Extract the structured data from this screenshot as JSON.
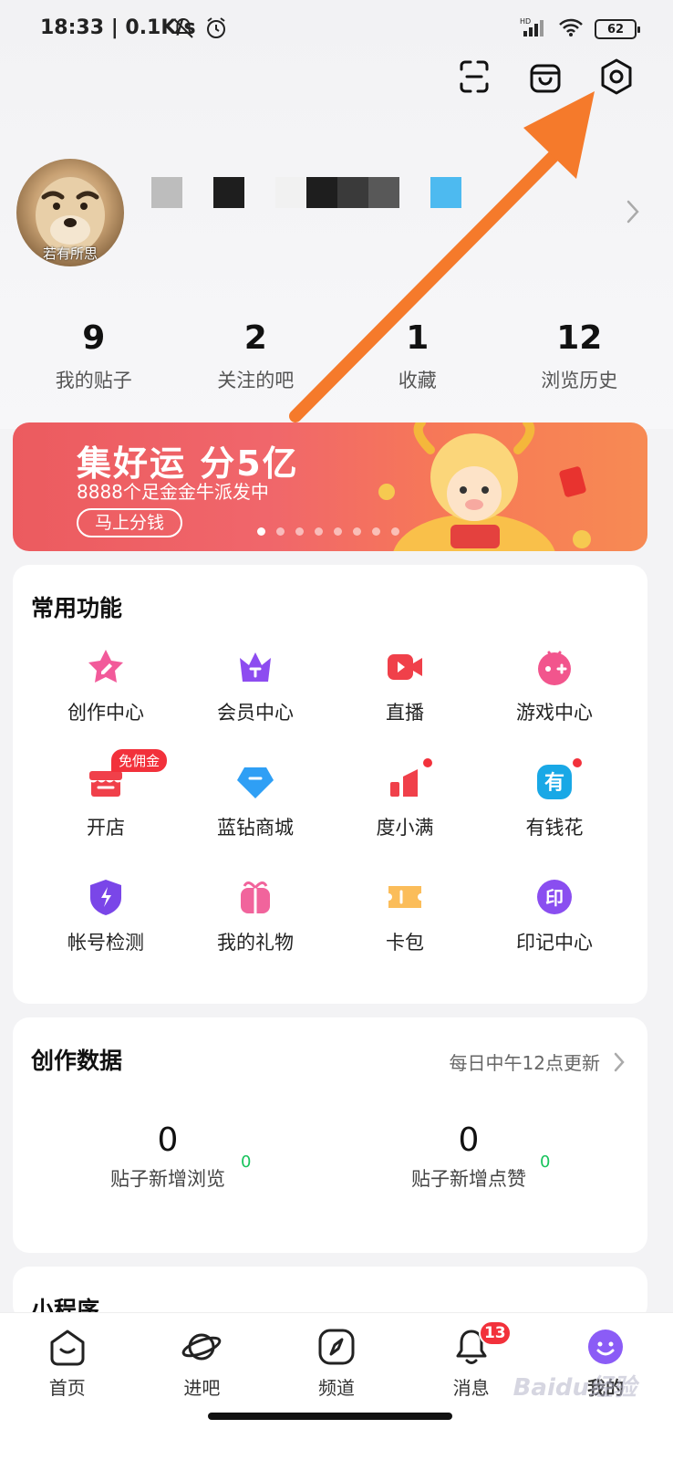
{
  "status_bar": {
    "time": "18:33 | 0.1K/s",
    "battery": "62",
    "network_label": "HD"
  },
  "profile": {
    "avatar_caption": "若有所思"
  },
  "stats": [
    {
      "num": "9",
      "label": "我的贴子"
    },
    {
      "num": "2",
      "label": "关注的吧"
    },
    {
      "num": "1",
      "label": "收藏"
    },
    {
      "num": "12",
      "label": "浏览历史"
    }
  ],
  "banner": {
    "title": "集好运 分5亿",
    "subtitle": "8888个足金金牛派发中",
    "button": "马上分钱",
    "dot_count": 8,
    "active_dot": 0
  },
  "common_functions": {
    "title": "常用功能",
    "items": [
      {
        "label": "创作中心",
        "icon": "star-pen-icon"
      },
      {
        "label": "会员中心",
        "icon": "crown-icon"
      },
      {
        "label": "直播",
        "icon": "video-camera-icon"
      },
      {
        "label": "游戏中心",
        "icon": "gamepad-icon"
      },
      {
        "label": "开店",
        "icon": "shop-icon",
        "badge": "免佣金"
      },
      {
        "label": "蓝钻商城",
        "icon": "diamond-icon"
      },
      {
        "label": "度小满",
        "icon": "bar-chart-icon"
      },
      {
        "label": "有钱花",
        "icon": "you-icon",
        "icon_text": "有"
      },
      {
        "label": "帐号检测",
        "icon": "shield-bolt-icon"
      },
      {
        "label": "我的礼物",
        "icon": "gift-icon"
      },
      {
        "label": "卡包",
        "icon": "ticket-icon"
      },
      {
        "label": "印记中心",
        "icon": "seal-icon",
        "icon_text": "印"
      }
    ]
  },
  "creation_data": {
    "title": "创作数据",
    "update_note": "每日中午12点更新",
    "items": [
      {
        "num": "0",
        "label": "贴子新增浏览",
        "delta": "0"
      },
      {
        "num": "0",
        "label": "贴子新增点赞",
        "delta": "0"
      }
    ]
  },
  "mini_programs": {
    "title": "小程序"
  },
  "bottom_nav": [
    {
      "label": "首页",
      "icon": "home-icon"
    },
    {
      "label": "进吧",
      "icon": "planet-icon"
    },
    {
      "label": "频道",
      "icon": "compass-icon"
    },
    {
      "label": "消息",
      "icon": "bell-icon",
      "badge": "13"
    },
    {
      "label": "我的",
      "icon": "smiley-avatar-icon"
    }
  ],
  "watermark": "Baidu经验",
  "colors": {
    "accent_red": "#f2313b",
    "banner_start": "#ec5b5f",
    "banner_end": "#f78a54",
    "arrow": "#f57a2b",
    "delta_green": "#18c35c"
  }
}
